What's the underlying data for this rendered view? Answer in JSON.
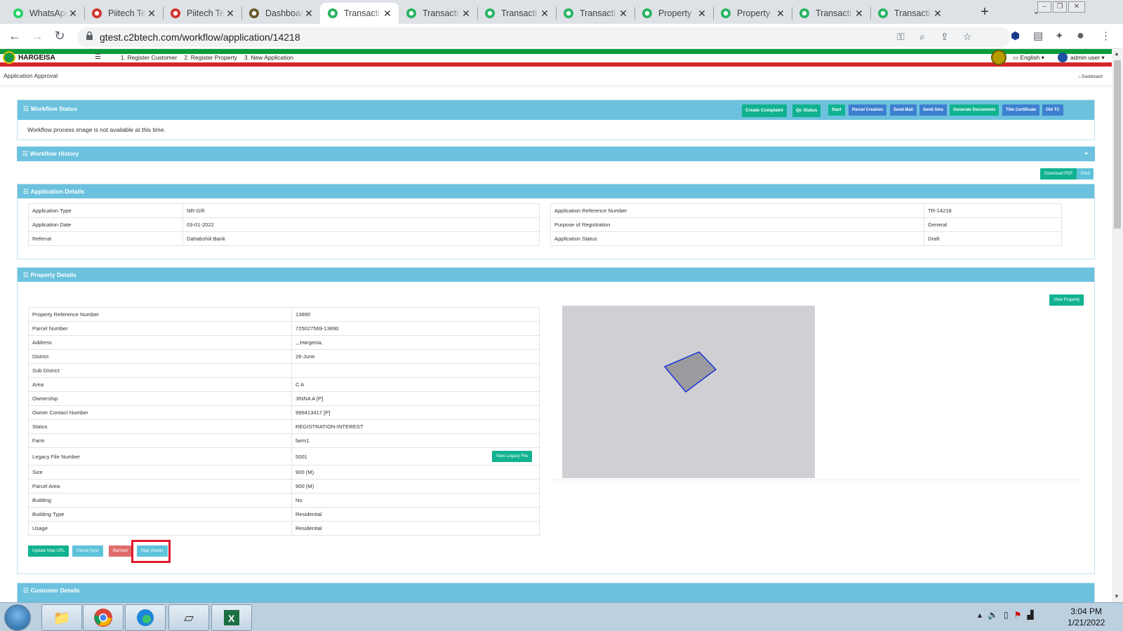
{
  "browser": {
    "tabs": [
      {
        "title": "WhatsApp",
        "icon": "whatsapp-icon",
        "active": false
      },
      {
        "title": "Piitech Te",
        "icon": "piitech-icon",
        "active": false
      },
      {
        "title": "Piitech Te",
        "icon": "piitech-icon",
        "active": false
      },
      {
        "title": "Dashboar",
        "icon": "dashboard-icon",
        "active": false
      },
      {
        "title": "Transacti",
        "icon": "app-icon",
        "active": true
      },
      {
        "title": "Transacti",
        "icon": "app-icon",
        "active": false
      },
      {
        "title": "Transacti",
        "icon": "app-icon",
        "active": false
      },
      {
        "title": "Transacti",
        "icon": "app-icon",
        "active": false
      },
      {
        "title": "Property",
        "icon": "app-icon",
        "active": false
      },
      {
        "title": "Property",
        "icon": "app-icon",
        "active": false
      },
      {
        "title": "Transacti",
        "icon": "app-icon",
        "active": false
      },
      {
        "title": "Transacti",
        "icon": "app-icon",
        "active": false
      }
    ],
    "url": "gtest.c2btech.com/workflow/application/14218"
  },
  "app": {
    "brand": "HARGEISA",
    "menu": [
      "1. Register Customer",
      "2. Register Property",
      "3. New Application"
    ],
    "language": "English",
    "user": "admin user",
    "page_title": "Application Approval",
    "breadcrumb": "Dashboard"
  },
  "workflow_status": {
    "title": "Workflow Status",
    "message": "Workflow process image is not available at this time.",
    "buttons": [
      "Create Complaint",
      "Qc Status",
      "Start",
      "Parcel Creation",
      "Send Mail",
      "Send Sms",
      "Generate Documents",
      "Title Certificate",
      "Old TC"
    ]
  },
  "workflow_history": {
    "title": "Workflow History"
  },
  "toolbar_buttons": {
    "download_pdf": "Download PDF",
    "print": "Print"
  },
  "application_details": {
    "title": "Application Details",
    "left": [
      [
        "Application Type",
        "NR-Gift"
      ],
      [
        "Application Date",
        "03-01-2022"
      ],
      [
        "Referral",
        "Dahabshiil Bank"
      ]
    ],
    "right": [
      [
        "Application Reference Number",
        "TR-14218"
      ],
      [
        "Purpose of Registration",
        "General"
      ],
      [
        "Application Status",
        "Draft"
      ]
    ]
  },
  "property_details": {
    "title": "Property Details",
    "view_property": "View Property",
    "view_legacy_file": "View Legacy File",
    "rows": [
      [
        "Property Reference Number",
        "13890"
      ],
      [
        "Parcel Number",
        "725027569-13890"
      ],
      [
        "Address",
        ",,,Hargeisa,"
      ],
      [
        "District",
        "26-June"
      ],
      [
        "Sub District",
        ""
      ],
      [
        "Area",
        "C A"
      ],
      [
        "Ownership",
        "JINNA A [P]"
      ],
      [
        "Owner Contact Number",
        "999413417 [P]"
      ],
      [
        "Status",
        "REGISTRATION-INTEREST"
      ],
      [
        "Farm",
        "farm1"
      ],
      [
        "Legacy File Number",
        "5001"
      ],
      [
        "Size",
        "900 (M)"
      ],
      [
        "Parcel Area",
        "900 (M)"
      ],
      [
        "Building",
        "No"
      ],
      [
        "Building Type",
        "Residential"
      ],
      [
        "Usage",
        "Residential"
      ]
    ],
    "actions": [
      "Update Map URL",
      "Parcel Sync",
      "Banned",
      "Map Viewer"
    ]
  },
  "customer_details": {
    "title": "Customer Details"
  },
  "taskbar": {
    "time": "3:04 PM",
    "date": "1/21/2022"
  }
}
